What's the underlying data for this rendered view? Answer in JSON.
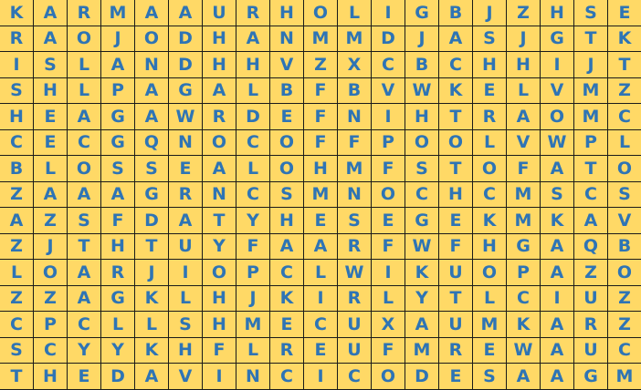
{
  "puzzle": {
    "letter_color": "#2E74B5",
    "background_color": "#FFD966",
    "grid_line_color": "#1a1a1a",
    "rows": [
      [
        "K",
        "A",
        "R",
        "M",
        "A",
        "A",
        "U",
        "R",
        "H",
        "O",
        "L",
        "I",
        "G",
        "B",
        "J",
        "Z",
        "H",
        "S",
        "E"
      ],
      [
        "R",
        "A",
        "O",
        "J",
        "O",
        "D",
        "H",
        "A",
        "N",
        "M",
        "M",
        "D",
        "J",
        "A",
        "S",
        "J",
        "G",
        "T",
        "K"
      ],
      [
        "I",
        "S",
        "L",
        "A",
        "N",
        "D",
        "H",
        "H",
        "V",
        "Z",
        "X",
        "C",
        "B",
        "C",
        "H",
        "H",
        "I",
        "J",
        "T"
      ],
      [
        "S",
        "H",
        "L",
        "P",
        "A",
        "G",
        "A",
        "L",
        "B",
        "F",
        "B",
        "V",
        "W",
        "K",
        "E",
        "L",
        "V",
        "M",
        "Z"
      ],
      [
        "H",
        "E",
        "A",
        "G",
        "A",
        "W",
        "R",
        "D",
        "E",
        "F",
        "N",
        "I",
        "H",
        "T",
        "R",
        "A",
        "O",
        "M",
        "C"
      ],
      [
        "C",
        "E",
        "C",
        "G",
        "Q",
        "N",
        "O",
        "C",
        "O",
        "F",
        "F",
        "P",
        "O",
        "O",
        "L",
        "V",
        "W",
        "P",
        "L"
      ],
      [
        "B",
        "L",
        "O",
        "S",
        "S",
        "E",
        "A",
        "L",
        "O",
        "H",
        "M",
        "F",
        "S",
        "T",
        "O",
        "F",
        "A",
        "T",
        "O"
      ],
      [
        "Z",
        "A",
        "A",
        "A",
        "G",
        "R",
        "N",
        "C",
        "S",
        "M",
        "N",
        "O",
        "C",
        "H",
        "C",
        "M",
        "S",
        "C",
        "S"
      ],
      [
        "A",
        "Z",
        "S",
        "F",
        "D",
        "A",
        "T",
        "Y",
        "H",
        "E",
        "S",
        "E",
        "G",
        "E",
        "K",
        "M",
        "K",
        "A",
        "V"
      ],
      [
        "Z",
        "J",
        "T",
        "H",
        "T",
        "U",
        "Y",
        "F",
        "A",
        "A",
        "R",
        "F",
        "W",
        "F",
        "H",
        "G",
        "A",
        "Q",
        "B"
      ],
      [
        "L",
        "O",
        "A",
        "R",
        "J",
        "I",
        "O",
        "P",
        "C",
        "L",
        "W",
        "I",
        "K",
        "U",
        "O",
        "P",
        "A",
        "Z",
        "O"
      ],
      [
        "Z",
        "Z",
        "A",
        "G",
        "K",
        "L",
        "H",
        "J",
        "K",
        "I",
        "R",
        "L",
        "Y",
        "T",
        "L",
        "C",
        "I",
        "U",
        "Z"
      ],
      [
        "C",
        "P",
        "C",
        "L",
        "L",
        "S",
        "H",
        "M",
        "E",
        "C",
        "U",
        "X",
        "A",
        "U",
        "M",
        "K",
        "A",
        "R",
        "Z"
      ],
      [
        "S",
        "C",
        "Y",
        "Y",
        "K",
        "H",
        "F",
        "L",
        "R",
        "E",
        "U",
        "F",
        "M",
        "R",
        "E",
        "W",
        "A",
        "U",
        "C"
      ],
      [
        "T",
        "H",
        "E",
        "D",
        "A",
        "V",
        "I",
        "N",
        "C",
        "I",
        "C",
        "O",
        "D",
        "E",
        "S",
        "A",
        "A",
        "G",
        "M"
      ]
    ]
  }
}
